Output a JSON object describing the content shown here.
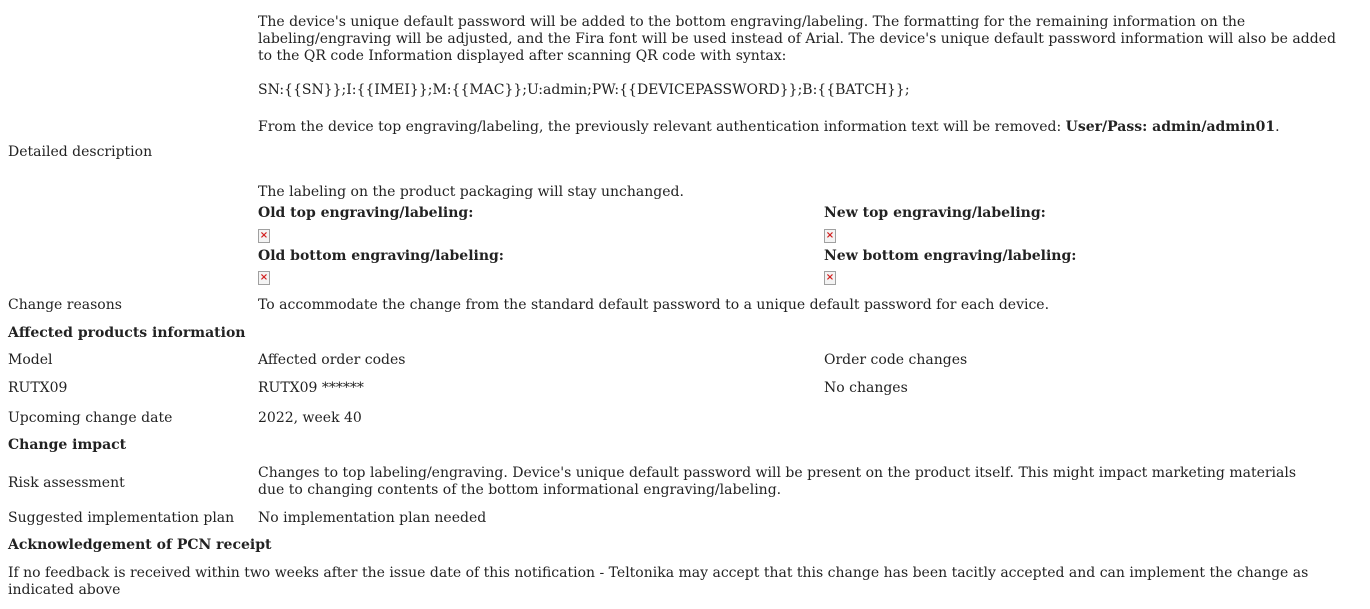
{
  "detailed": {
    "label": "Detailed description",
    "para1": "The device's unique default password will be added to the bottom engraving/labeling. The formatting for the remaining information on the labeling/engraving will be adjusted, and the Fira font will be used instead of Arial. The device's unique default password information will also be added to the QR code Information displayed after scanning QR code with syntax:",
    "syntax": "SN:{{SN}};I:{{IMEI}};M:{{MAC}};U:admin;PW:{{DEVICEPASSWORD}};B:{{BATCH}};",
    "para2_text": "From the device top engraving/labeling, the previously relevant authentication information text will be removed: ",
    "para2_bold": "User/Pass: admin/admin01",
    "para2_end": ".",
    "para3": "The labeling on the product packaging will stay unchanged.",
    "old_top": "Old top engraving/labeling:",
    "new_top": "New top engraving/labeling:",
    "old_bottom": "Old bottom engraving/labeling:",
    "new_bottom": "New bottom engraving/labeling:",
    "broken_image_glyph": "×"
  },
  "change_reasons": {
    "label": "Change reasons",
    "value": "To accommodate the change from the standard default password to a unique default password for each device."
  },
  "affected": {
    "heading": "Affected products information",
    "col_model": "Model",
    "col_codes": "Affected order codes",
    "col_changes": "Order code changes",
    "rows": [
      {
        "model": "RUTX09",
        "codes": "RUTX09 ******",
        "changes": "No changes"
      }
    ]
  },
  "upcoming": {
    "label": "Upcoming change date",
    "value": "2022, week 40"
  },
  "impact": {
    "heading": "Change impact",
    "risk_label": "Risk assessment",
    "risk_value": "Changes to top labeling/engraving. Device's unique default password will be present on the product itself. This might impact marketing materials due to changing contents of the bottom informational engraving/labeling.",
    "plan_label": "Suggested implementation plan",
    "plan_value": "No implementation plan needed"
  },
  "ack": {
    "heading": "Acknowledgement of PCN receipt",
    "text": "If no feedback is received within two weeks after the issue date of this notification - Teltonika may accept that this change has been tacitly accepted and can implement the change as indicated above"
  }
}
